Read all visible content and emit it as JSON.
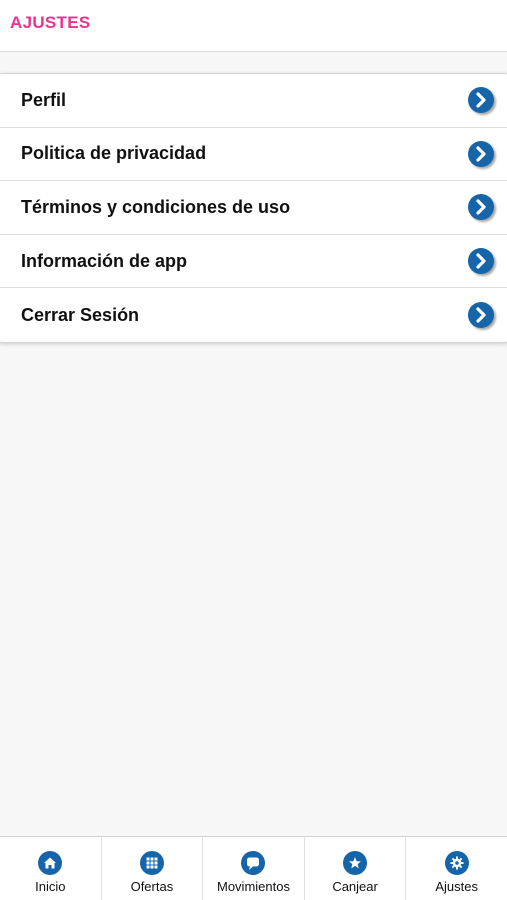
{
  "header": {
    "title": "AJUSTES"
  },
  "menu": {
    "items": [
      {
        "label": "Perfil"
      },
      {
        "label": "Politica de privacidad"
      },
      {
        "label": "Términos y condiciones de uso"
      },
      {
        "label": "Información de app"
      },
      {
        "label": "Cerrar Sesión"
      }
    ],
    "chevron_icon": "chevron-right-circle-icon"
  },
  "tabbar": {
    "tabs": [
      {
        "label": "Inicio",
        "icon": "home-icon"
      },
      {
        "label": "Ofertas",
        "icon": "grid-icon"
      },
      {
        "label": "Movimientos",
        "icon": "chat-bubble-icon"
      },
      {
        "label": "Canjear",
        "icon": "star-icon"
      },
      {
        "label": "Ajustes",
        "icon": "gear-icon"
      }
    ],
    "active_tab": "Ajustes"
  },
  "colors": {
    "accent": "#e8338f",
    "icon_blue": "#1565a8",
    "background": "#f7f7f7"
  }
}
